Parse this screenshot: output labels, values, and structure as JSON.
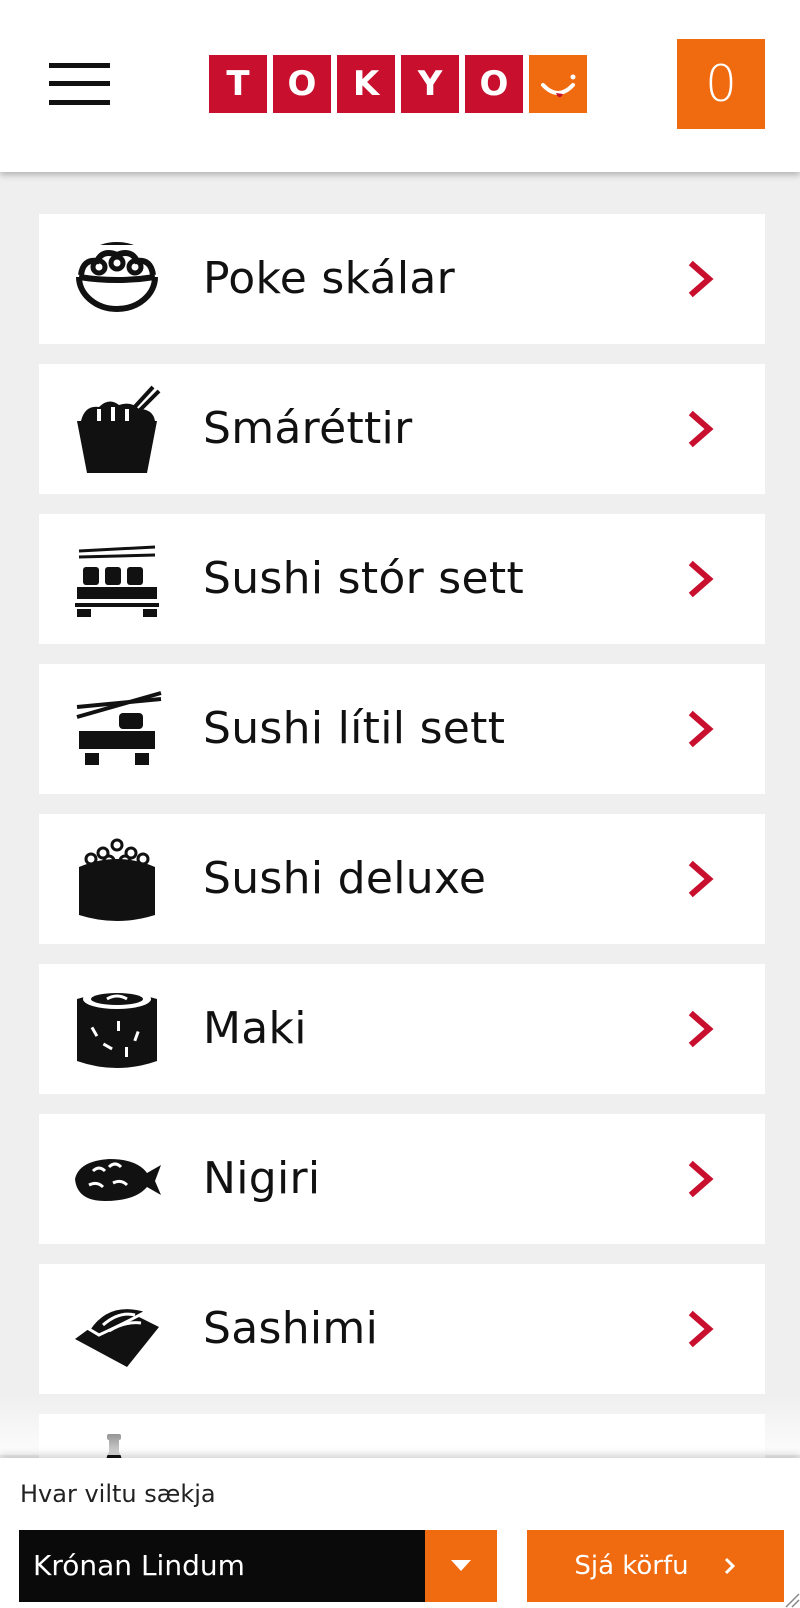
{
  "header": {
    "menu_icon": "hamburger-menu-icon",
    "logo_letters": [
      "T",
      "O",
      "K",
      "Y",
      "O"
    ],
    "logo_smile_icon": "smile-icon",
    "cart_count": "0",
    "brand_red": "#c8102e",
    "brand_orange": "#f06a0f"
  },
  "categories": [
    {
      "label": "Poke skálar",
      "icon": "poke-bowl-icon"
    },
    {
      "label": "Smáréttir",
      "icon": "small-dish-icon"
    },
    {
      "label": "Sushi stór sett",
      "icon": "large-sushi-set-icon"
    },
    {
      "label": "Sushi lítil sett",
      "icon": "small-sushi-set-icon"
    },
    {
      "label": "Sushi deluxe",
      "icon": "sushi-deluxe-icon"
    },
    {
      "label": "Maki",
      "icon": "maki-icon"
    },
    {
      "label": "Nigiri",
      "icon": "nigiri-icon"
    },
    {
      "label": "Sashimi",
      "icon": "sashimi-icon"
    }
  ],
  "footer": {
    "pickup_label": "Hvar viltu sækja",
    "store_value": "Krónan Lindum",
    "view_cart_label": "Sjá körfu"
  }
}
